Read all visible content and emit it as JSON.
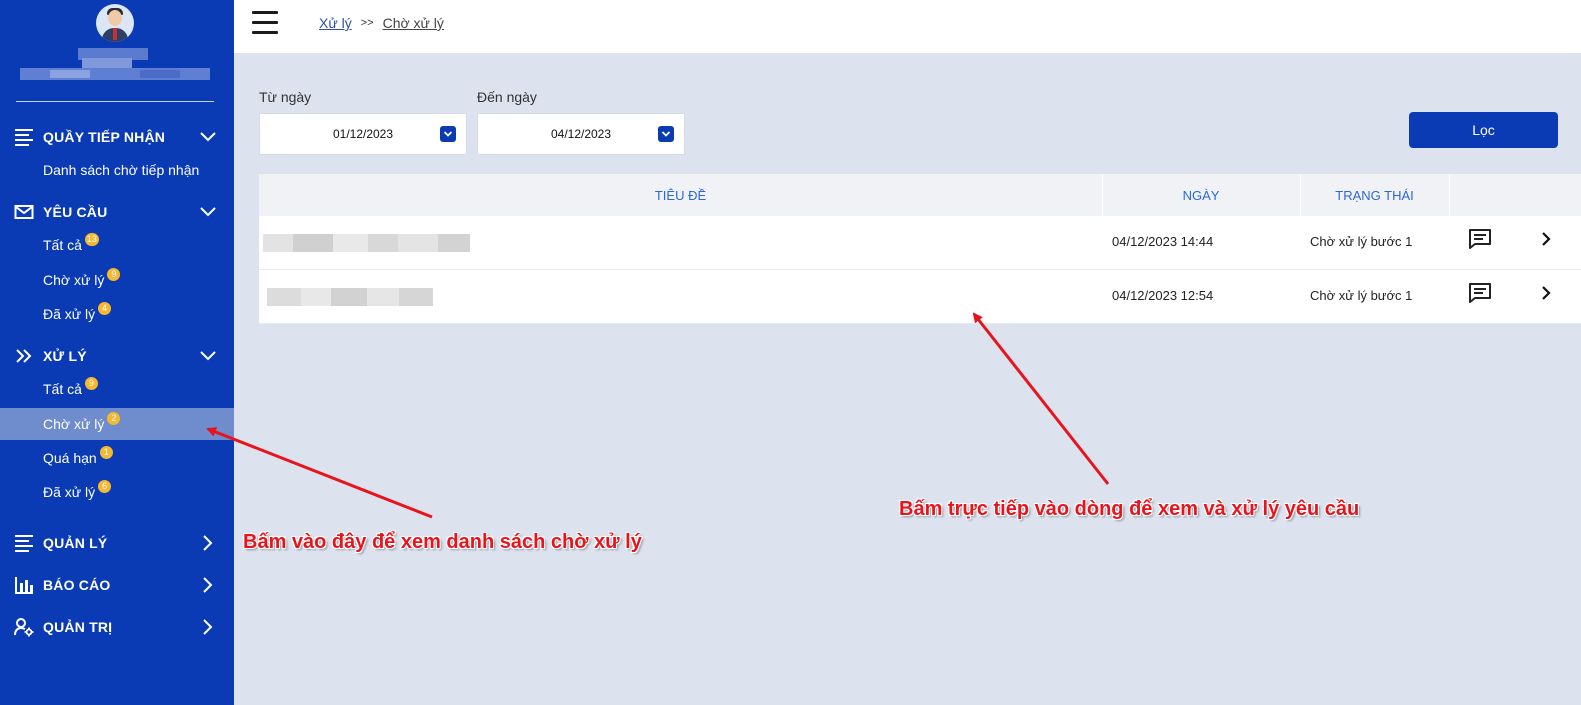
{
  "breadcrumb": {
    "parent": "Xử lý",
    "separator": ">>",
    "current": "Chờ xử lý"
  },
  "sidebar": {
    "sections": [
      {
        "title": "QUẦY TIẾP NHẬN",
        "icon": "list-icon",
        "expanded": true,
        "items": [
          {
            "label": "Danh sách chờ tiếp nhận"
          }
        ]
      },
      {
        "title": "YÊU CẦU",
        "icon": "mail-icon",
        "expanded": true,
        "items": [
          {
            "label": "Tất cả",
            "badge": "13"
          },
          {
            "label": "Chờ xử lý",
            "badge": "9"
          },
          {
            "label": "Đã xử lý",
            "badge": "4"
          }
        ]
      },
      {
        "title": "XỬ LÝ",
        "icon": "double-chevron-icon",
        "expanded": true,
        "items": [
          {
            "label": "Tất cả",
            "badge": "9"
          },
          {
            "label": "Chờ xử lý",
            "badge": "2",
            "active": true
          },
          {
            "label": "Quá hạn",
            "badge": "1"
          },
          {
            "label": "Đã xử lý",
            "badge": "6"
          }
        ]
      },
      {
        "title": "QUẢN LÝ",
        "icon": "list-icon",
        "expanded": false,
        "items": []
      },
      {
        "title": "BÁO CÁO",
        "icon": "bar-chart-icon",
        "expanded": false,
        "items": []
      },
      {
        "title": "QUẢN TRỊ",
        "icon": "user-settings-icon",
        "expanded": false,
        "items": []
      }
    ]
  },
  "filters": {
    "from_label": "Từ ngày",
    "from_value": "01/12/2023",
    "to_label": "Đến ngày",
    "to_value": "04/12/2023",
    "button_label": "Lọc"
  },
  "table": {
    "columns": [
      "TIÊU ĐỀ",
      "NGÀY",
      "TRẠNG THÁI"
    ],
    "rows": [
      {
        "date": "04/12/2023 14:44",
        "status": "Chờ xử lý bước 1"
      },
      {
        "date": "04/12/2023 12:54",
        "status": "Chờ xử lý bước 1"
      }
    ]
  },
  "annotations": {
    "sidebar_hint": "Bấm vào đây để xem danh sách chờ xử lý",
    "row_hint": "Bấm trực tiếp vào dòng để xem và xử lý yêu cầu"
  },
  "colors": {
    "sidebar_bg": "#0a3bb5",
    "active_item": "#6f8ccd",
    "badge": "#f5b82e",
    "annotation": "#e8141c",
    "header_text": "#2c67d8"
  }
}
